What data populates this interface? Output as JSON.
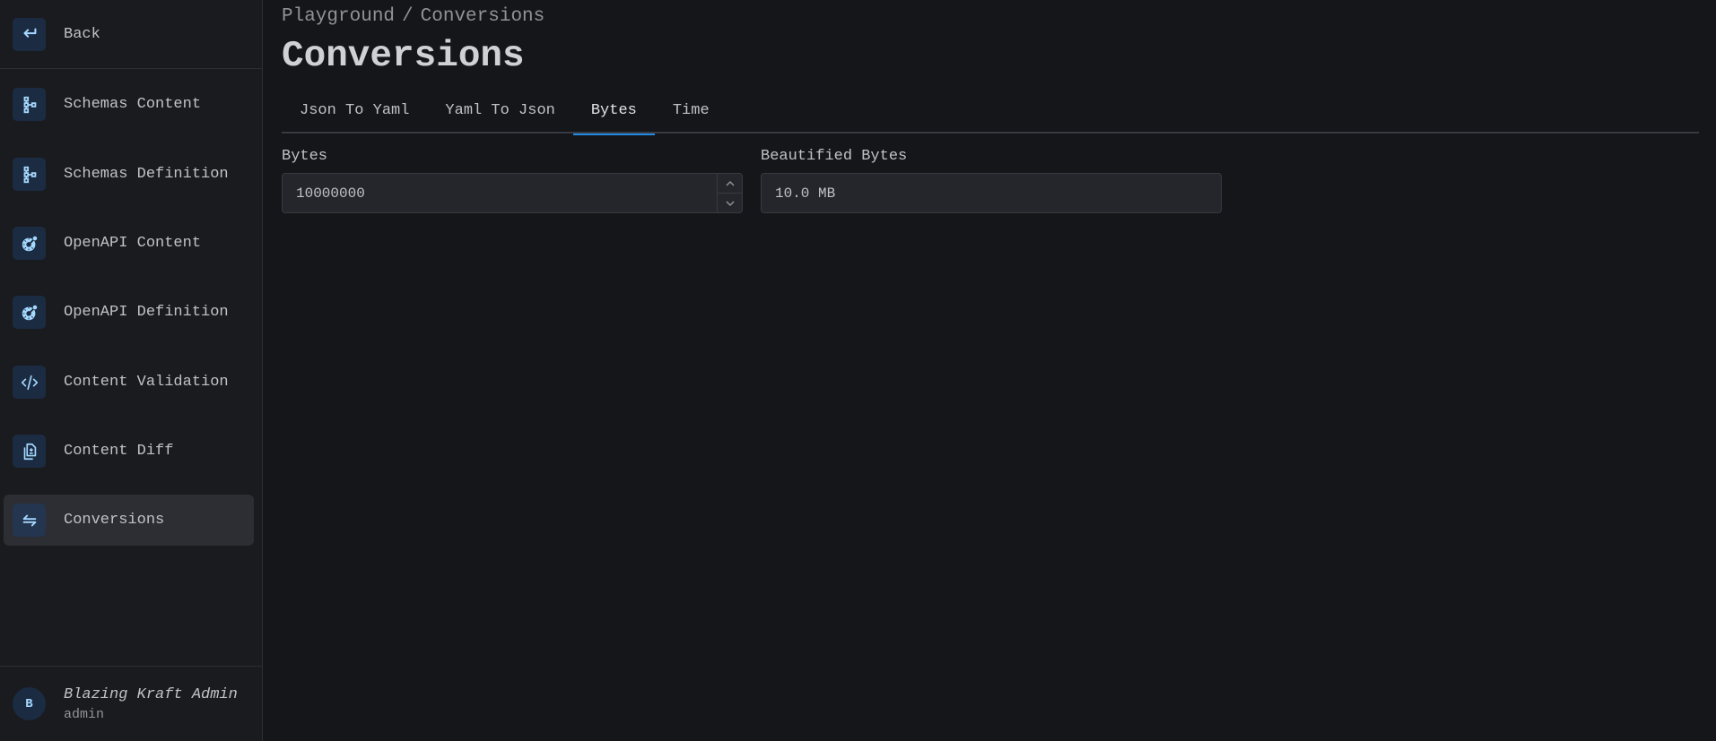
{
  "sidebar": {
    "back_label": "Back",
    "items": [
      {
        "label": "Schemas Content",
        "icon": "schema-tree-icon"
      },
      {
        "label": "Schemas Definition",
        "icon": "schema-tree-icon"
      },
      {
        "label": "OpenAPI Content",
        "icon": "openapi-icon"
      },
      {
        "label": "OpenAPI Definition",
        "icon": "openapi-icon"
      },
      {
        "label": "Content Validation",
        "icon": "code-icon"
      },
      {
        "label": "Content Diff",
        "icon": "file-diff-icon"
      },
      {
        "label": "Conversions",
        "icon": "arrows-exchange-icon",
        "active": true
      }
    ],
    "user": {
      "avatar_initial": "B",
      "name": "Blazing Kraft Admin",
      "role": "admin"
    }
  },
  "breadcrumb": {
    "parent": "Playground",
    "separator": "/",
    "current": "Conversions"
  },
  "page_title": "Conversions",
  "tabs": [
    {
      "label": "Json To Yaml"
    },
    {
      "label": "Yaml To Json"
    },
    {
      "label": "Bytes",
      "active": true
    },
    {
      "label": "Time"
    }
  ],
  "form": {
    "bytes": {
      "label": "Bytes",
      "value": "10000000"
    },
    "beautified": {
      "label": "Beautified Bytes",
      "value": "10.0 MB"
    }
  },
  "colors": {
    "accent": "#228be6",
    "icon": "#a5d8ff",
    "background": "#151619",
    "sidebar": "#1a1b1e"
  }
}
